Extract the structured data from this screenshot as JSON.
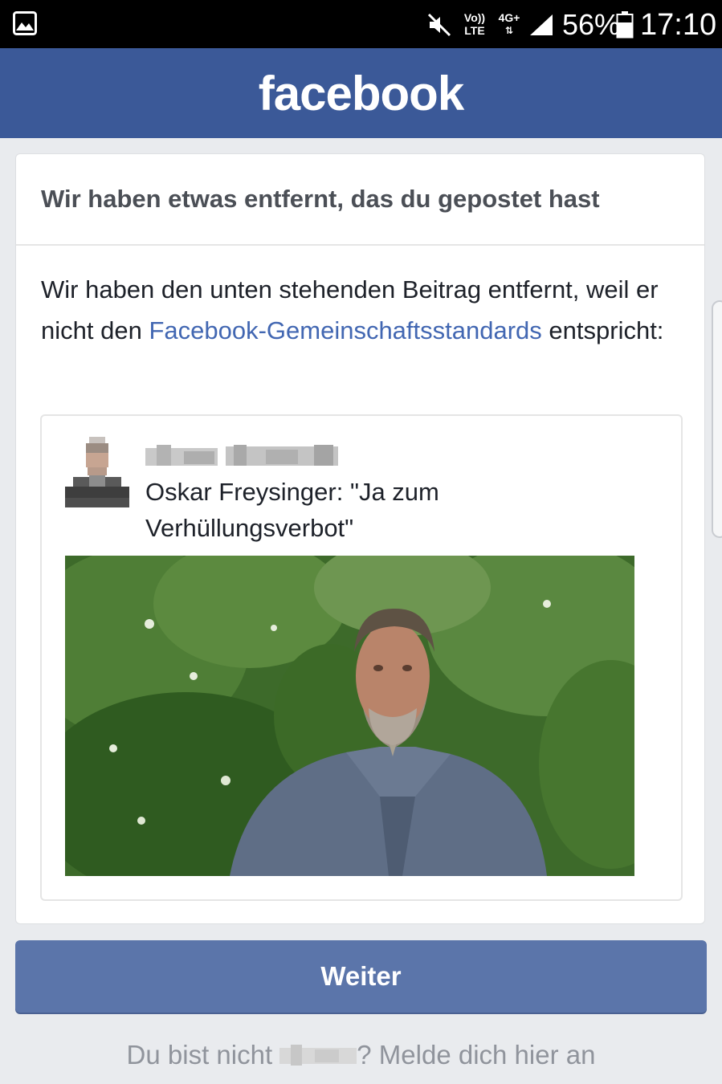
{
  "status_bar": {
    "volte_line1": "Vo))",
    "volte_line2": "LTE",
    "network_type": "4G+",
    "network_arrows": "⇅",
    "battery_percent": "56%",
    "time": "17:10",
    "icons": [
      "gallery-icon",
      "mute-icon",
      "signal-icon",
      "battery-icon"
    ]
  },
  "header": {
    "logo_text": "facebook",
    "brand_color": "#3b5998"
  },
  "dialog": {
    "title": "Wir haben etwas entfernt, das du gepostet hast",
    "message_prefix": "Wir haben den unten stehenden Beitrag entfernt, weil er nicht den ",
    "message_link": "Facebook-Gemeinschaftsstandards",
    "message_suffix": " entspricht:",
    "link_color": "#4267b2"
  },
  "post": {
    "text": "Oskar Freysinger: \"Ja zum Verhüllungsverbot\""
  },
  "actions": {
    "continue_label": "Weiter",
    "button_color": "#5b75aa"
  },
  "login_hint": {
    "prefix": "Du bist nicht ",
    "suffix": "? Melde dich hier an"
  }
}
